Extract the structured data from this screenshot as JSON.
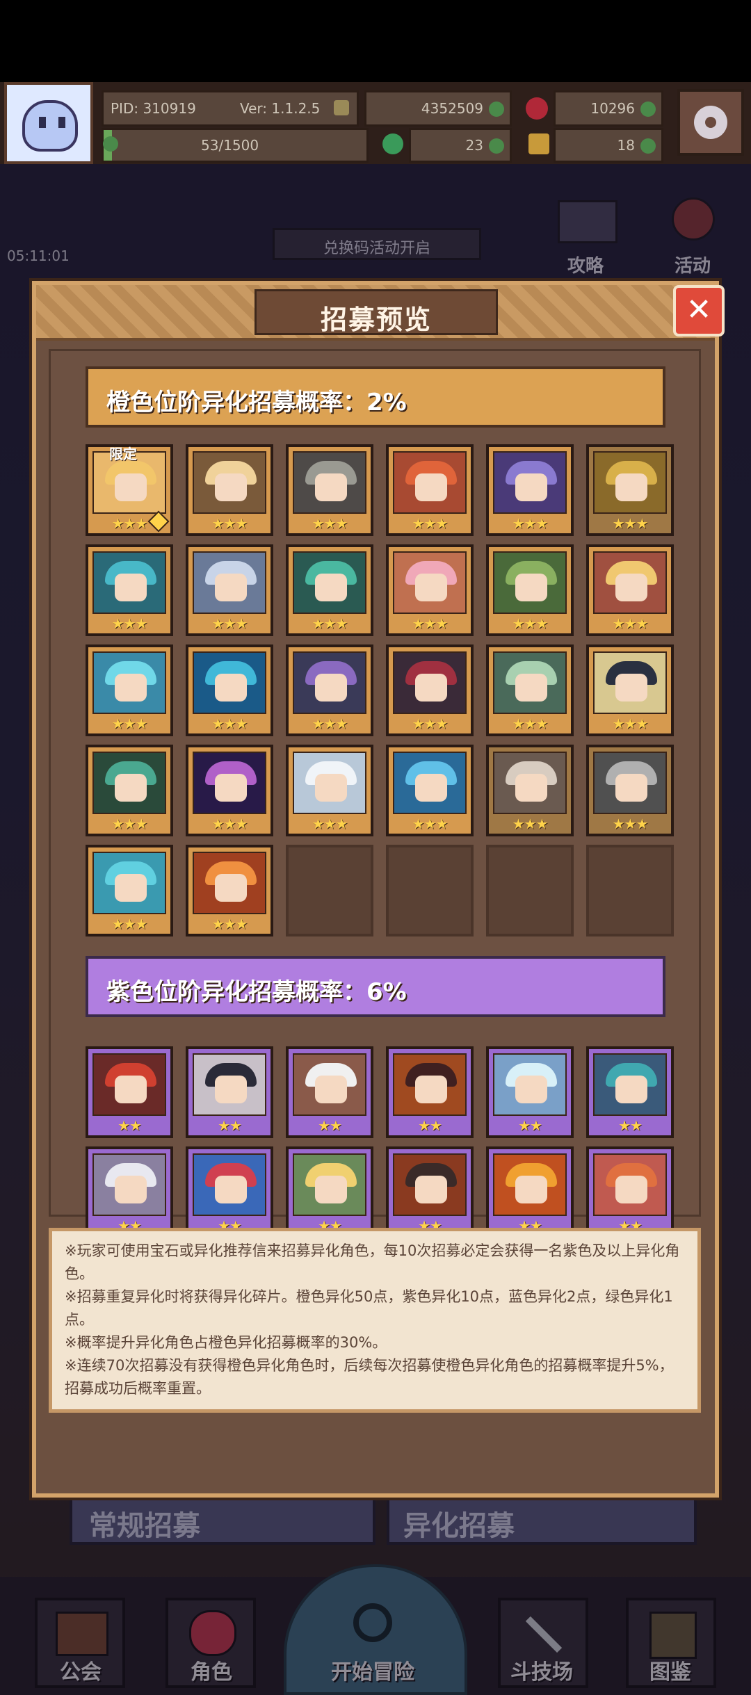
{
  "topbar": {
    "pid": "PID: 310919",
    "version": "Ver: 1.1.2.5",
    "gold": "4352509",
    "gems": "10296",
    "stamina": "53/1500",
    "clover": "23",
    "shard": "18"
  },
  "background": {
    "time": "05:11:01",
    "event_label": "兑换码活动开启",
    "guide_label": "攻略",
    "activity_label": "活动",
    "normal_recruit_label": "常规招募",
    "alien_recruit_label": "异化招募"
  },
  "modal": {
    "title": "招募预览",
    "orange_rate": "橙色位阶异化招募概率：2%",
    "purple_rate": "紫色位阶异化招募概率：6%",
    "limited_badge": "限定",
    "orange_stars": "★★★",
    "purple_stars": "★★",
    "orange_cards": [
      {
        "hair": "#f2c66a",
        "bg": "#e9b86c",
        "limited": true,
        "pip": true
      },
      {
        "hair": "#f0d29a",
        "bg": "#7a5a3a"
      },
      {
        "hair": "#9a9a92",
        "bg": "#4e4a48"
      },
      {
        "hair": "#e0643a",
        "bg": "#a84a32"
      },
      {
        "hair": "#8a7ad0",
        "bg": "#4a3a78"
      },
      {
        "hair": "#d8b04a",
        "bg": "#8a6a2a",
        "dim": true
      },
      {
        "hair": "#48b8c8",
        "bg": "#2a6a78"
      },
      {
        "hair": "#c8d4e8",
        "bg": "#6a7a98"
      },
      {
        "hair": "#4ab8a0",
        "bg": "#2a5a52"
      },
      {
        "hair": "#f0a8b8",
        "bg": "#c07050"
      },
      {
        "hair": "#8ab060",
        "bg": "#4a6a3a"
      },
      {
        "hair": "#f0c870",
        "bg": "#a05040"
      },
      {
        "hair": "#70d8e8",
        "bg": "#3a8aa8"
      },
      {
        "hair": "#40b8d8",
        "bg": "#1a5a88"
      },
      {
        "hair": "#8a6ac0",
        "bg": "#3a3a58"
      },
      {
        "hair": "#a03040",
        "bg": "#3a2a38"
      },
      {
        "hair": "#a8d0b0",
        "bg": "#4a6a5a"
      },
      {
        "hair": "#2a3040",
        "bg": "#d8c890"
      },
      {
        "hair": "#4aa890",
        "bg": "#2a4a3a"
      },
      {
        "hair": "#b060c8",
        "bg": "#281a48"
      },
      {
        "hair": "#f0f4f8",
        "bg": "#b8c8d8"
      },
      {
        "hair": "#60c0e8",
        "bg": "#2a6a98"
      },
      {
        "hair": "#d8ccc0",
        "bg": "#6a5a50",
        "dim": true
      },
      {
        "hair": "#b0b0b0",
        "bg": "#505050",
        "dim": true
      },
      {
        "hair": "#60d0e0",
        "bg": "#3a9ab0"
      },
      {
        "hair": "#f09040",
        "bg": "#a04020"
      }
    ],
    "purple_cards": [
      {
        "hair": "#d04030",
        "bg": "#6a2a28"
      },
      {
        "hair": "#2a2a38",
        "bg": "#c8c0c8"
      },
      {
        "hair": "#f0f0f0",
        "bg": "#8a5a4a"
      },
      {
        "hair": "#402020",
        "bg": "#a04a20"
      },
      {
        "hair": "#d8f0f8",
        "bg": "#7aa0c8"
      },
      {
        "hair": "#40a8b0",
        "bg": "#3a5a7a"
      },
      {
        "hair": "#e8e8f0",
        "bg": "#8a80a0"
      },
      {
        "hair": "#d04050",
        "bg": "#3a68b8"
      },
      {
        "hair": "#f0d070",
        "bg": "#6a8a5a"
      },
      {
        "hair": "#3a2a28",
        "bg": "#8a3a20"
      },
      {
        "hair": "#f0a030",
        "bg": "#c05020"
      },
      {
        "hair": "#e07040",
        "bg": "#c05a50"
      }
    ],
    "notes": [
      "※玩家可使用宝石或异化推荐信来招募异化角色，每10次招募必定会获得一名紫色及以上异化角色。",
      "※招募重复异化时将获得异化碎片。橙色异化50点，紫色异化10点，蓝色异化2点，绿色异化1点。",
      "※概率提升异化角色占橙色异化招募概率的30%。",
      "※连续70次招募没有获得橙色异化角色时，后续每次招募使橙色异化角色的招募概率提升5%，招募成功后概率重置。"
    ]
  },
  "nav": {
    "guild": "公会",
    "roles": "角色",
    "adventure": "开始冒险",
    "arena": "斗技场",
    "codex": "图鉴"
  }
}
